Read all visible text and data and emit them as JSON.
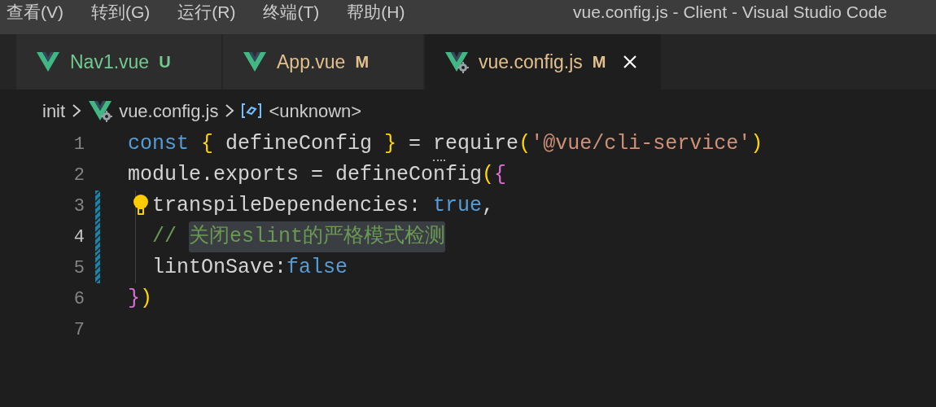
{
  "menu": [
    "查看(V)",
    "转到(G)",
    "运行(R)",
    "终端(T)",
    "帮助(H)"
  ],
  "window": {
    "title": "vue.config.js - Client - Visual Studio Code"
  },
  "tabs": [
    {
      "label": "Nav1.vue",
      "status": "U",
      "kind": "vue",
      "selected": false
    },
    {
      "label": "App.vue",
      "status": "M",
      "kind": "vue",
      "selected": false
    },
    {
      "label": "vue.config.js",
      "status": "M",
      "kind": "vue-config",
      "selected": true
    }
  ],
  "breadcrumb": [
    {
      "label": "init",
      "kind": "folder"
    },
    {
      "label": "vue.config.js",
      "kind": "vue-config"
    },
    {
      "label": "<unknown>",
      "kind": "symbol"
    }
  ],
  "lines": [
    {
      "number": "1",
      "active": false,
      "modified": false,
      "indented": false,
      "lightbulb": false,
      "tokens": [
        {
          "text": "const ",
          "kind": "keyword"
        },
        {
          "text": "{ ",
          "kind": "brace"
        },
        {
          "text": "defineConfig ",
          "kind": "plain"
        },
        {
          "text": "} ",
          "kind": "brace"
        },
        {
          "text": "= ",
          "kind": "plain"
        },
        {
          "text": "require",
          "kind": "plain",
          "hint": true
        },
        {
          "text": "(",
          "kind": "brace"
        },
        {
          "text": "'@vue/cli-service'",
          "kind": "string"
        },
        {
          "text": ")",
          "kind": "brace"
        }
      ]
    },
    {
      "number": "2",
      "active": false,
      "modified": false,
      "indented": false,
      "lightbulb": false,
      "tokens": [
        {
          "text": "module.exports = defineConfig",
          "kind": "plain"
        },
        {
          "text": "(",
          "kind": "brace"
        },
        {
          "text": "{",
          "kind": "brace2"
        }
      ]
    },
    {
      "number": "3",
      "active": false,
      "modified": true,
      "indented": true,
      "lightbulb": true,
      "tokens": [
        {
          "text": "transpileDependencies: ",
          "kind": "plain"
        },
        {
          "text": "true",
          "kind": "keyword"
        },
        {
          "text": ",",
          "kind": "plain"
        }
      ]
    },
    {
      "number": "4",
      "active": true,
      "modified": true,
      "indented": true,
      "lightbulb": false,
      "tokens": [
        {
          "text": "// ",
          "kind": "comment"
        },
        {
          "text": "关闭eslint的严格模式检测",
          "kind": "comment",
          "highlighted": true
        }
      ]
    },
    {
      "number": "5",
      "active": false,
      "modified": true,
      "indented": true,
      "lightbulb": false,
      "tokens": [
        {
          "text": "lintOnSave:",
          "kind": "plain"
        },
        {
          "text": "false",
          "kind": "keyword"
        }
      ]
    },
    {
      "number": "6",
      "active": false,
      "modified": false,
      "indented": false,
      "lightbulb": false,
      "tokens": [
        {
          "text": "}",
          "kind": "brace2"
        },
        {
          "text": ")",
          "kind": "brace"
        }
      ]
    },
    {
      "number": "7",
      "active": false,
      "modified": false,
      "indented": false,
      "lightbulb": false
    }
  ]
}
